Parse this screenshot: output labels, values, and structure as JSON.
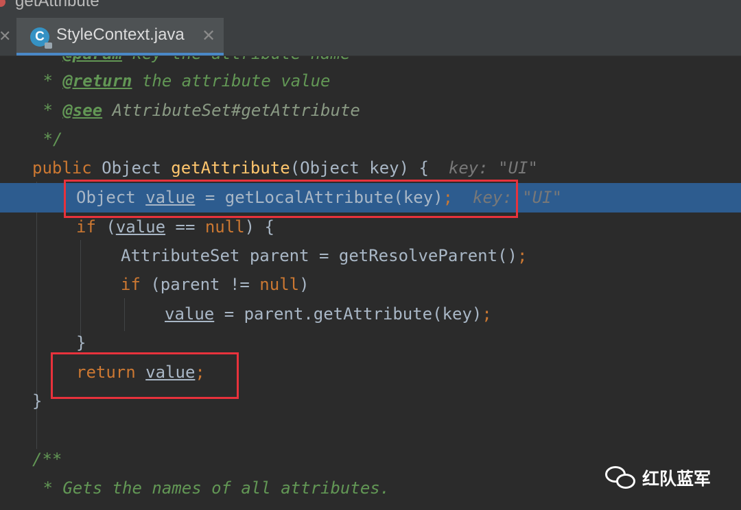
{
  "window": {
    "title": "getAttribute"
  },
  "tab": {
    "label": "StyleContext.java",
    "file_icon_letter": "C",
    "close_symbol": "✕",
    "prev_close_symbol": "✕"
  },
  "code": {
    "l0": {
      "a": " * ",
      "tag": "@param",
      "b": " key the attribute name"
    },
    "l1": {
      "a": " * ",
      "tag": "@return",
      "b": " the attribute value"
    },
    "l2": {
      "a": " * ",
      "tag": "@see",
      "b": " ",
      "c": "AttributeSet#getAttribute"
    },
    "l3": {
      "a": " */"
    },
    "l4": {
      "kw": "public",
      "b": " Object ",
      "fn": "getAttribute",
      "c": "(Object key) {",
      "hint": "key: \"UI\""
    },
    "l5": {
      "a": "Object ",
      "var": "value",
      "b": " = getLocalAttribute(key)",
      "semi": ";",
      "hint": "key: \"UI\""
    },
    "l6": {
      "kw": "if",
      "a": " (",
      "var": "value",
      "b": " == ",
      "kw2": "null",
      "c": ") {"
    },
    "l7": {
      "a": "AttributeSet parent = getResolveParent()",
      "semi": ";"
    },
    "l8": {
      "kw": "if",
      "a": " (parent != ",
      "kw2": "null",
      "b": ")"
    },
    "l9": {
      "var": "value",
      "a": " = parent.getAttribute(key)",
      "semi": ";"
    },
    "l10": {
      "a": "}"
    },
    "l11": {
      "kw": "return",
      "b": " ",
      "var": "value",
      "semi": ";"
    },
    "l12": {
      "a": "}"
    },
    "l14": {
      "a": "/**"
    },
    "l15": {
      "a": " * Gets the names of all attributes."
    }
  },
  "watermark": {
    "text": "红队蓝军"
  },
  "colors": {
    "editor_bg": "#2b2b2b",
    "keyword": "#cc7832",
    "comment": "#629755",
    "function": "#ffc66d",
    "text": "#a9b7c6",
    "hint": "#787878",
    "highlight_line": "#2d5c8f",
    "annotation_box": "#e8323c",
    "tab_underline": "#4a88c7"
  }
}
